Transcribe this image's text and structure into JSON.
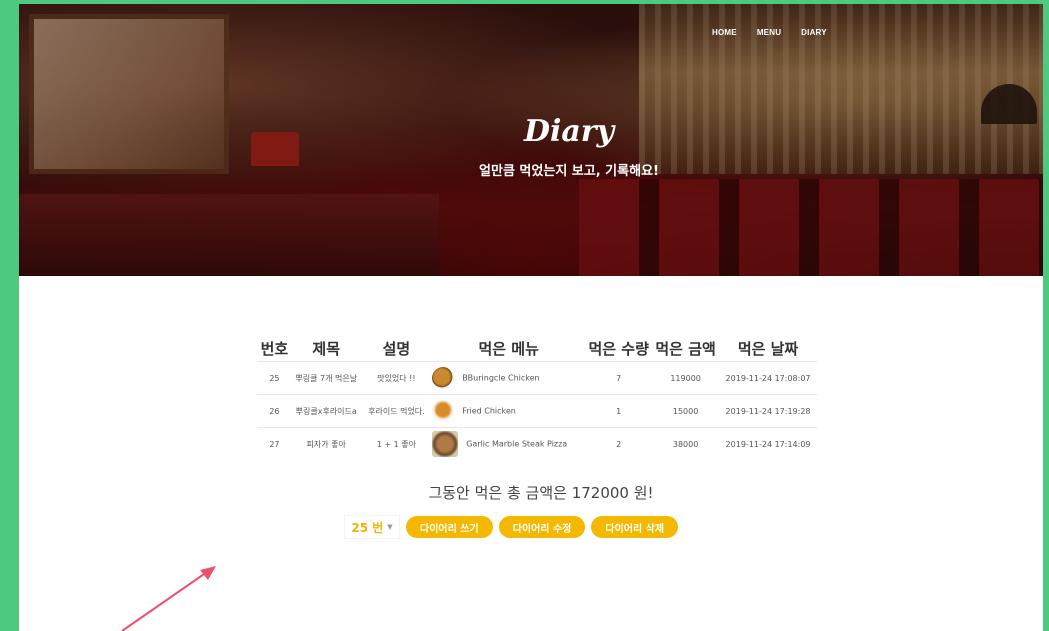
{
  "nav": {
    "items": [
      "HOME",
      "MENU",
      "DIARY"
    ]
  },
  "hero": {
    "title": "Diary",
    "subtitle": "얼만큼 먹었는지 보고, 기록해요!"
  },
  "table": {
    "headers": [
      "번호",
      "제목",
      "설명",
      "먹은 메뉴",
      "먹은 수량",
      "먹은 금액",
      "먹은 날짜"
    ],
    "rows": [
      {
        "no": "25",
        "title": "뿌링클 7개 먹은날",
        "desc": "맛있었다 !!",
        "menu": "BBuringcle Chicken",
        "qty": "7",
        "price": "119000",
        "date": "2019-11-24 17:08:07",
        "icon": "chicken-dish-icon"
      },
      {
        "no": "26",
        "title": "뿌링클x후라이드a",
        "desc": "후라이드 먹었다.",
        "menu": "Fried Chicken",
        "qty": "1",
        "price": "15000",
        "date": "2019-11-24 17:19:28",
        "icon": "fried-chicken-icon"
      },
      {
        "no": "27",
        "title": "피자가 좋아",
        "desc": "1 + 1 좋아",
        "menu": "Garlic Marble Steak Pizza",
        "qty": "2",
        "price": "38000",
        "date": "2019-11-24 17:14:09",
        "icon": "pizza-icon"
      }
    ]
  },
  "summary": {
    "total_text": "그동안 먹은 총 금액은 172000 원!"
  },
  "controls": {
    "selected": "25 번",
    "write_label": "다이어리 쓰기",
    "edit_label": "다이어리 수정",
    "delete_label": "다이어리 삭제"
  },
  "colors": {
    "accent": "#f5b800",
    "frame": "#4dca80",
    "annotation_arrow": "#e8536a"
  }
}
